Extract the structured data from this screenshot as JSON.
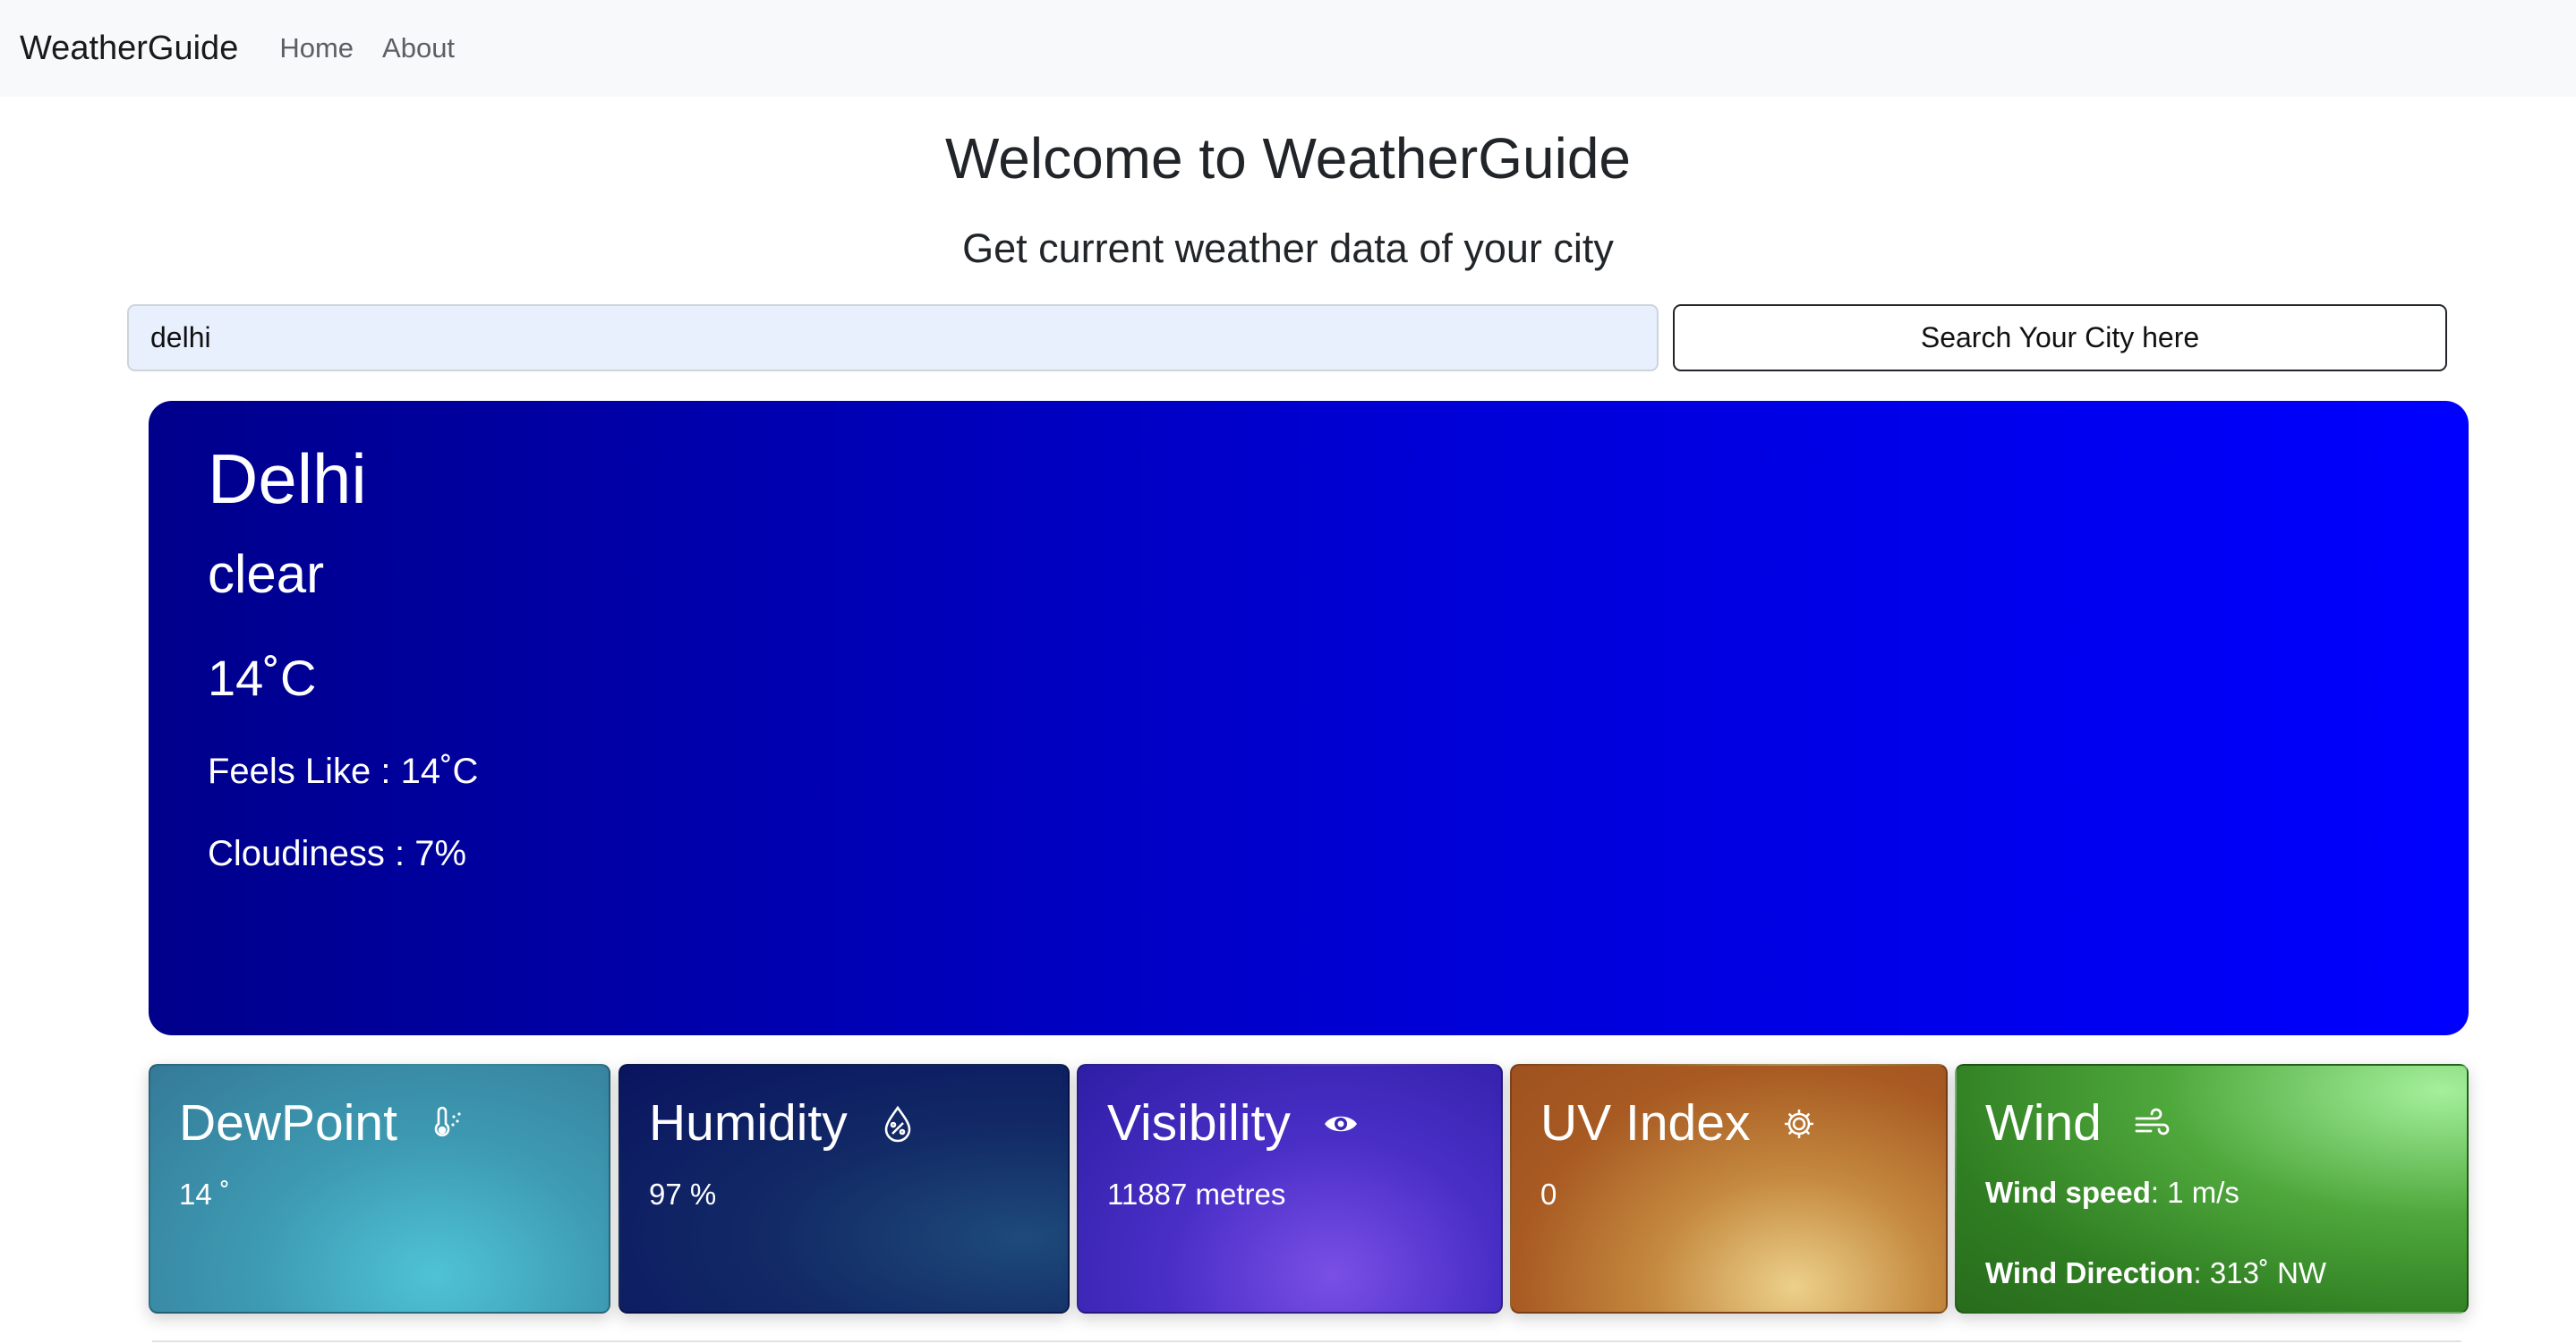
{
  "navbar": {
    "brand": "WeatherGuide",
    "links": [
      "Home",
      "About"
    ]
  },
  "header": {
    "title": "Welcome to WeatherGuide",
    "subtitle": "Get current weather data of your city"
  },
  "search": {
    "value": "delhi",
    "button_label": "Search Your City here"
  },
  "main_card": {
    "city": "Delhi",
    "condition": "clear",
    "temperature": "14˚C",
    "feels_like": "Feels Like : 14˚C",
    "cloudiness": "Cloudiness : 7%",
    "gradient_colors": [
      "#00008b",
      "#0000ff"
    ]
  },
  "cards": {
    "dewpoint": {
      "title": "DewPoint",
      "value": "14 ˚",
      "icon": "thermometer-snow-icon"
    },
    "humidity": {
      "title": "Humidity",
      "value": "97 %",
      "icon": "droplet-percent-icon"
    },
    "visibility": {
      "title": "Visibility",
      "value": "11887 metres",
      "icon": "eye-icon"
    },
    "uv_index": {
      "title": "UV Index",
      "value": "0",
      "icon": "gear-sun-icon"
    },
    "wind": {
      "title": "Wind",
      "icon": "wind-icon",
      "speed_label": "Wind speed",
      "speed_value": ": 1 m/s",
      "direction_label": "Wind Direction",
      "direction_value": ": 313˚ NW"
    }
  }
}
